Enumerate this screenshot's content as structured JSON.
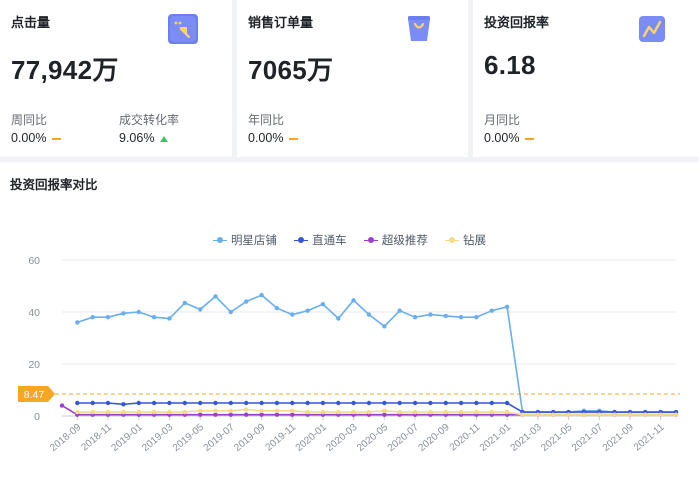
{
  "kpis": [
    {
      "title": "点击量",
      "icon": "cursor-click-icon",
      "value": "77,942万",
      "subs": [
        {
          "label": "周同比",
          "value": "0.00%",
          "trend": "flat"
        },
        {
          "label": "成交转化率",
          "value": "9.06%",
          "trend": "up"
        }
      ]
    },
    {
      "title": "销售订单量",
      "icon": "shopping-bag-icon",
      "value": "7065万",
      "subs": [
        {
          "label": "年同比",
          "value": "0.00%",
          "trend": "flat"
        }
      ]
    },
    {
      "title": "投资回报率",
      "icon": "trend-line-icon",
      "value": "6.18",
      "subs": [
        {
          "label": "月同比",
          "value": "0.00%",
          "trend": "flat"
        }
      ]
    }
  ],
  "colors": {
    "flat": "#f5a623",
    "up": "#3fc46a",
    "icon_bg": "#6b7ff0"
  },
  "section": {
    "title": "投资回报率对比"
  },
  "chart_data": {
    "type": "line",
    "title": "",
    "xlabel": "",
    "ylabel": "",
    "ylim": [
      0,
      60
    ],
    "yticks": [
      0,
      20,
      40,
      60
    ],
    "grid": true,
    "legend_position": "top-center",
    "x": [
      "2018-08",
      "2018-09",
      "2018-10",
      "2018-11",
      "2018-12",
      "2019-01",
      "2019-02",
      "2019-03",
      "2019-04",
      "2019-05",
      "2019-06",
      "2019-07",
      "2019-08",
      "2019-09",
      "2019-10",
      "2019-11",
      "2019-12",
      "2020-01",
      "2020-02",
      "2020-03",
      "2020-04",
      "2020-05",
      "2020-06",
      "2020-07",
      "2020-08",
      "2020-09",
      "2020-10",
      "2020-11",
      "2020-12",
      "2021-01",
      "2021-02",
      "2021-03",
      "2021-04",
      "2021-05",
      "2021-06",
      "2021-07",
      "2021-08",
      "2021-09",
      "2021-10",
      "2021-11",
      "2021-12"
    ],
    "x_tick_labels": [
      "2018-09",
      "2018-11",
      "2019-01",
      "2019-03",
      "2019-05",
      "2019-07",
      "2019-09",
      "2019-11",
      "2020-01",
      "2020-03",
      "2020-05",
      "2020-07",
      "2020-09",
      "2020-11",
      "2021-01",
      "2021-03",
      "2021-05",
      "2021-07",
      "2021-09",
      "2021-11"
    ],
    "mark_line": {
      "value": 8.47,
      "label": "8.47",
      "color": "#f5a623"
    },
    "series": [
      {
        "name": "明星店铺",
        "color": "#69aef0",
        "values": [
          null,
          36,
          38,
          38,
          39.5,
          40,
          38,
          37.5,
          43.5,
          41,
          46,
          40,
          44,
          46.5,
          41.5,
          39,
          40.5,
          43,
          37.5,
          44.5,
          39,
          34.5,
          40.5,
          38,
          39,
          38.5,
          38,
          38,
          40.5,
          42,
          1.5,
          1.5,
          1.5,
          1.5,
          2,
          2,
          1.5,
          1.5,
          1.5,
          1.5,
          1.5
        ]
      },
      {
        "name": "直通车",
        "color": "#3556d6",
        "values": [
          null,
          5,
          5,
          5,
          4.5,
          5,
          5,
          5,
          5,
          5,
          5,
          5,
          5,
          5,
          5,
          5,
          5,
          5,
          5,
          5,
          5,
          5,
          5,
          5,
          5,
          5,
          5,
          5,
          5,
          5,
          1.5,
          1.5,
          1.5,
          1.5,
          1.5,
          1.5,
          1.5,
          1.5,
          1.5,
          1.5,
          1.5
        ]
      },
      {
        "name": "超级推荐",
        "color": "#9b3fd1",
        "values": [
          4,
          0.5,
          0.5,
          0.5,
          0.5,
          0.5,
          0.5,
          0.5,
          0.5,
          0.5,
          0.5,
          0.5,
          0.5,
          0.5,
          0.5,
          0.5,
          0.5,
          0.5,
          0.5,
          0.5,
          0.5,
          0.5,
          0.5,
          0.5,
          0.5,
          0.5,
          0.5,
          0.5,
          0.5,
          0.5,
          0.5,
          0.5,
          0.5,
          0.5,
          0.5,
          0.5,
          0.5,
          0.5,
          0.5,
          0.5,
          0.5
        ]
      },
      {
        "name": "钻展",
        "color": "#f7d98c",
        "values": [
          null,
          1.5,
          1.5,
          1.5,
          1.5,
          1.5,
          1.5,
          1.5,
          1.5,
          2,
          2,
          2,
          2.5,
          2,
          2,
          2,
          1.5,
          1.5,
          1.5,
          1.5,
          1.5,
          2,
          1.5,
          1.5,
          1.5,
          1.5,
          1.5,
          1.5,
          1.5,
          1.5,
          0.5,
          0.5,
          0.5,
          0.5,
          0.5,
          0.5,
          0.5,
          0.5,
          0.5,
          0.5,
          0.5
        ]
      }
    ]
  }
}
